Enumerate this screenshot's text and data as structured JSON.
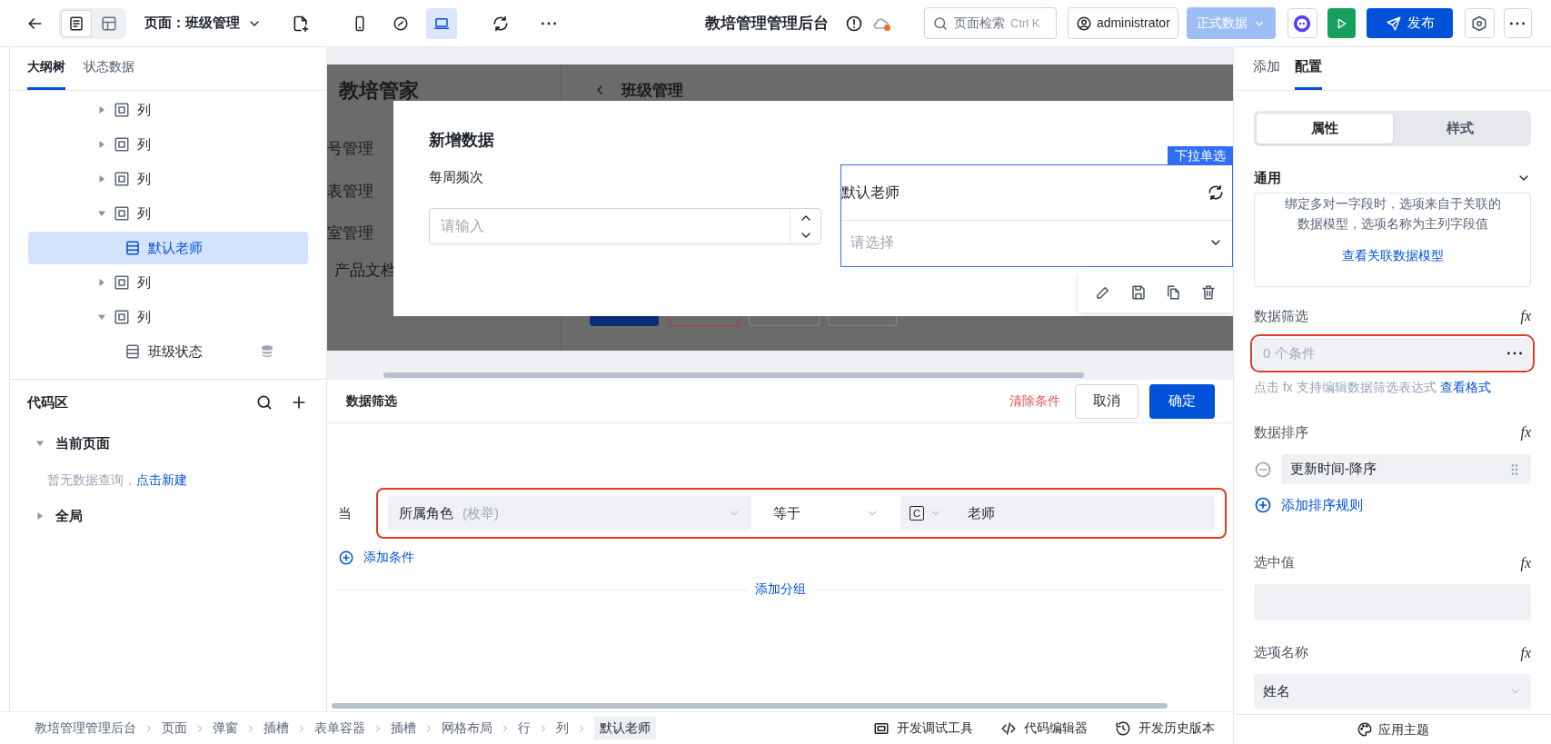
{
  "toolbar": {
    "view_toggles": [
      {
        "kind": "page",
        "selected": true
      },
      {
        "kind": "layout",
        "selected": false
      }
    ],
    "page_label": "页面：班级管理",
    "devices": [
      {
        "kind": "mobile",
        "selected": false
      },
      {
        "kind": "mini",
        "selected": false
      },
      {
        "kind": "desktop",
        "selected": true
      }
    ],
    "title": "教培管理管理后台",
    "search": {
      "placeholder": "页面检索",
      "shortcut": "Ctrl K"
    },
    "user": "administrator",
    "environment": "正式数据",
    "publish": "发布"
  },
  "left_panel": {
    "tabs": [
      {
        "label": "大纲树",
        "selected": true
      },
      {
        "label": "状态数据",
        "selected": false
      }
    ],
    "tree": [
      {
        "label": "列",
        "kind": "column",
        "expanded": false,
        "selected": false
      },
      {
        "label": "列",
        "kind": "column",
        "expanded": false,
        "selected": false
      },
      {
        "label": "列",
        "kind": "column",
        "expanded": false,
        "selected": false
      },
      {
        "label": "列",
        "kind": "column",
        "expanded": true,
        "selected": false,
        "children": [
          {
            "label": "默认老师",
            "kind": "field",
            "selected": true,
            "data_bound": false
          }
        ]
      },
      {
        "label": "列",
        "kind": "column",
        "expanded": false,
        "selected": false
      },
      {
        "label": "列",
        "kind": "column",
        "expanded": true,
        "selected": false,
        "children": [
          {
            "label": "班级状态",
            "kind": "field",
            "selected": false,
            "data_bound": true
          }
        ]
      }
    ],
    "code_area": {
      "title": "代码区",
      "groups": [
        {
          "label": "当前页面",
          "expanded": true,
          "empty_text": "暂无数据查询，",
          "empty_link": "点击新建"
        },
        {
          "label": "全局",
          "expanded": false
        }
      ]
    }
  },
  "canvas": {
    "preview": {
      "app_name": "教培管家",
      "menu": [
        "号管理",
        "表管理",
        "室管理",
        "产品文档"
      ],
      "page_title": "班级管理"
    },
    "modal": {
      "title": "新增数据",
      "fields": [
        {
          "kind": "number",
          "label": "每周频次",
          "placeholder": "请输入",
          "selected": false
        },
        {
          "kind": "select",
          "label": "默认老师",
          "placeholder": "请选择",
          "selected": true,
          "component_tag": "下拉单选"
        }
      ]
    }
  },
  "filter_panel": {
    "title": "数据筛选",
    "clear": "清除条件",
    "cancel": "取消",
    "confirm": "确定",
    "conditions": [
      {
        "prefix": "当",
        "field": "所属角色",
        "field_type": "(枚举)",
        "operator": "等于",
        "value_type": "C",
        "value": "老师",
        "highlighted": true
      }
    ],
    "add_condition": "添加条件",
    "add_group": "添加分组"
  },
  "breadcrumb": [
    {
      "label": "教培管理管理后台",
      "selected": false
    },
    {
      "label": "页面",
      "selected": false
    },
    {
      "label": "弹窗",
      "selected": false
    },
    {
      "label": "插槽",
      "selected": false
    },
    {
      "label": "表单容器",
      "selected": false
    },
    {
      "label": "插槽",
      "selected": false
    },
    {
      "label": "网格布局",
      "selected": false
    },
    {
      "label": "行",
      "selected": false
    },
    {
      "label": "列",
      "selected": false
    },
    {
      "label": "默认老师",
      "selected": true
    }
  ],
  "dev_tools": [
    {
      "kind": "debug",
      "label": "开发调试工具"
    },
    {
      "kind": "code",
      "label": "代码编辑器"
    },
    {
      "kind": "history",
      "label": "开发历史版本"
    }
  ],
  "right_panel": {
    "tabs": [
      {
        "label": "添加",
        "selected": false
      },
      {
        "label": "配置",
        "selected": true
      }
    ],
    "segments": [
      {
        "label": "属性",
        "selected": true
      },
      {
        "label": "样式",
        "selected": false
      }
    ],
    "section": {
      "title": "通用",
      "expanded": true
    },
    "description": [
      "绑定多对一字段时，选项来自于关联的",
      "数据模型，选项名称为主列字段值"
    ],
    "model_link": "查看关联数据模型",
    "filter": {
      "label": "数据筛选",
      "formula": "fx",
      "value": "0 个条件",
      "highlighted": true,
      "hint": "点击 fx 支持编辑数据筛选表达式",
      "hint_link": "查看格式"
    },
    "sort": {
      "label": "数据排序",
      "formula": "fx",
      "rules": [
        "更新时间-降序"
      ],
      "add": "添加排序规则"
    },
    "selected_value": {
      "label": "选中值",
      "formula": "fx"
    },
    "option_name": {
      "label": "选项名称",
      "formula": "fx",
      "value": "姓名"
    },
    "theme": "应用主题"
  }
}
